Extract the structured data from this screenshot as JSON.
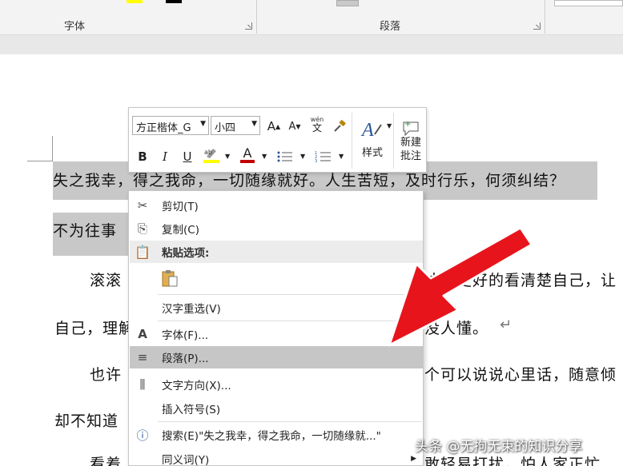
{
  "ribbon": {
    "font_group_label": "字体",
    "paragraph_group_label": "段落"
  },
  "document": {
    "line1": "失之我幸，得之我命，一切随缘就好。人生苦短，及时行乐，何须纠结？",
    "line2": "不为往事",
    "line3_left": "滚滚",
    "line3_right": "才能更好的看清楚自己，让",
    "line4_left": "自己，理解",
    "line4_right": "没人懂。",
    "line5_left": "也许",
    "line5_right": "个可以说说心里话，随意倾",
    "line6_left": "却不知道",
    "line7_left": "看着",
    "line7_right": "敢轻易打扰，怕人家正忙"
  },
  "mini_toolbar": {
    "font_name": "方正楷体_G",
    "font_size": "小四",
    "grow_font_label": "A",
    "shrink_font_label": "A",
    "phonetic_top": "wén",
    "phonetic_char": "文",
    "bold": "B",
    "italic": "I",
    "underline": "U",
    "font_color_label": "A",
    "styles_label": "样式",
    "new_comment_line1": "新建",
    "new_comment_line2": "批注",
    "highlight_color": "#ffff00",
    "font_color": "#c00000"
  },
  "context_menu": {
    "cut": "剪切(T)",
    "copy": "复制(C)",
    "paste_options": "粘贴选项:",
    "reconvert": "汉字重选(V)",
    "font": "字体(F)...",
    "paragraph": "段落(P)...",
    "text_direction": "文字方向(X)...",
    "insert_symbol": "插入符号(S)",
    "search": "搜索(E)\"失之我幸，得之我命，一切随缘就...\"",
    "synonyms": "同义词(Y)"
  },
  "annotation": {
    "arrow_color": "#e8141c"
  },
  "watermark": "头条 @无拘无束的知识分享"
}
